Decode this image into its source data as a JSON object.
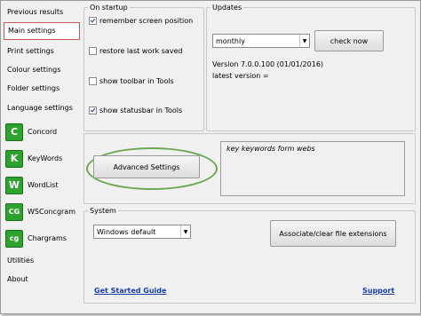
{
  "sidebar": {
    "items": [
      {
        "label": "Previous results"
      },
      {
        "label": "Main settings"
      },
      {
        "label": "Print settings"
      },
      {
        "label": "Colour settings"
      },
      {
        "label": "Folder settings"
      },
      {
        "label": "Language settings"
      },
      {
        "label": "Concord",
        "icon": "C"
      },
      {
        "label": "KeyWords",
        "icon": "K"
      },
      {
        "label": "WordList",
        "icon": "W"
      },
      {
        "label": "WSConcgram",
        "icon": "CG"
      },
      {
        "label": "Chargrams",
        "icon": "cg"
      },
      {
        "label": "Utilities"
      },
      {
        "label": "About"
      }
    ],
    "active_index": 1,
    "icon_color": "#2ea12e"
  },
  "startup": {
    "legend": "On startup",
    "options": [
      {
        "label": "remember screen position",
        "checked": true
      },
      {
        "label": "restore last work saved",
        "checked": false
      },
      {
        "label": "show toolbar in Tools",
        "checked": false
      },
      {
        "label": "show statusbar in Tools",
        "checked": true
      }
    ]
  },
  "updates": {
    "legend": "Updates",
    "frequency": "monthly",
    "check_now_label": "check now",
    "version_text": "Version 7.0.0.100 (01/01/2016)",
    "latest_text": "latest version ="
  },
  "advanced": {
    "button_label": "Advanced Settings",
    "keywords_text": "key keywords form webs",
    "highlight_color": "#6aa84f"
  },
  "system": {
    "legend": "System",
    "theme": "Windows default",
    "associate_label": "Associate/clear file extensions"
  },
  "footer": {
    "get_started": "Get Started Guide",
    "support": "Support"
  }
}
